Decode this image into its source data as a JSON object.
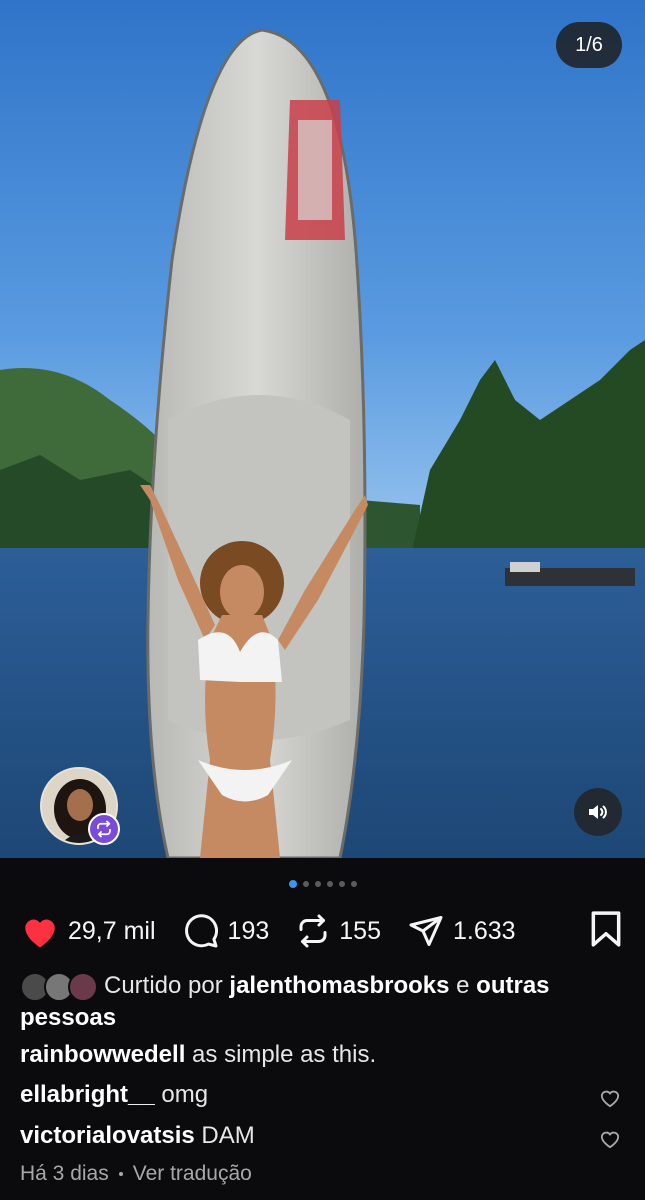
{
  "post": {
    "counter": "1/6",
    "slide_total": 6,
    "slide_current": 1
  },
  "actions": {
    "likes": "29,7 mil",
    "comments": "193",
    "reposts": "155",
    "shares": "1.633"
  },
  "liked_by": {
    "prefix": "Curtido por",
    "user": "jalenthomasbrooks",
    "joiner": "e",
    "others": "outras pessoas"
  },
  "caption": {
    "username": "rainbowwedell",
    "text": "as simple as this."
  },
  "comments": [
    {
      "username": "ellabright__",
      "text": "omg"
    },
    {
      "username": "victorialovatsis",
      "text": "DAM"
    }
  ],
  "meta": {
    "time": "Há 3 dias",
    "translate": "Ver tradução"
  },
  "colors": {
    "like_red": "#ff3040",
    "accent_blue": "#3897f0",
    "repost_badge": "#7a4bd9"
  },
  "icons": [
    "heart-filled-icon",
    "comment-bubble-icon",
    "repost-icon",
    "send-icon",
    "bookmark-icon",
    "speaker-icon",
    "repost-badge-icon",
    "heart-outline-icon"
  ]
}
